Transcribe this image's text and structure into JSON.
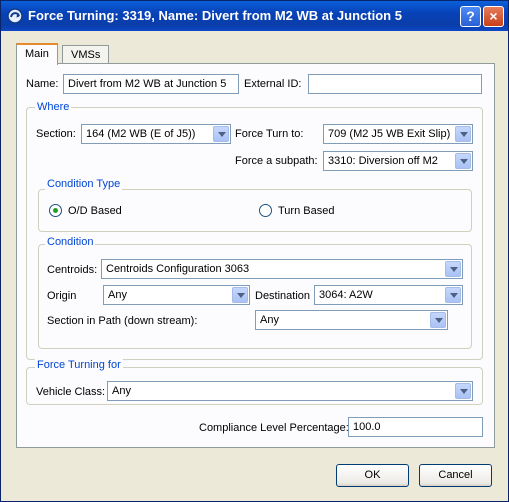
{
  "window": {
    "title": "Force Turning: 3319, Name: Divert from M2 WB at Junction 5",
    "help_glyph": "?",
    "close_glyph": "×"
  },
  "tabs": [
    {
      "label": "Main"
    },
    {
      "label": "VMSs"
    }
  ],
  "form": {
    "name_label": "Name:",
    "name_value": "Divert from M2 WB at Junction 5",
    "external_id_label": "External ID:",
    "external_id_value": ""
  },
  "where": {
    "legend": "Where",
    "section_label": "Section:",
    "section_value": "164 (M2 WB (E of J5))",
    "force_turn_label": "Force Turn to:",
    "force_turn_value": "709 (M2 J5 WB Exit Slip)",
    "subpath_label": "Force a subpath:",
    "subpath_value": "3310: Diversion off M2"
  },
  "condition_type": {
    "legend": "Condition Type",
    "od_label": "O/D Based",
    "turn_label": "Turn Based",
    "selected": "od"
  },
  "condition": {
    "legend": "Condition",
    "centroids_label": "Centroids:",
    "centroids_value": "Centroids Configuration 3063",
    "origin_label": "Origin",
    "origin_value": "Any",
    "destination_label": "Destination",
    "destination_value": "3064: A2W",
    "section_path_label": "Section in Path (down stream):",
    "section_path_value": "Any"
  },
  "force_turning_for": {
    "legend": "Force Turning for",
    "vehicle_class_label": "Vehicle Class:",
    "vehicle_class_value": "Any"
  },
  "compliance": {
    "label": "Compliance Level Percentage:",
    "value": "100.0"
  },
  "buttons": {
    "ok": "OK",
    "cancel": "Cancel"
  }
}
